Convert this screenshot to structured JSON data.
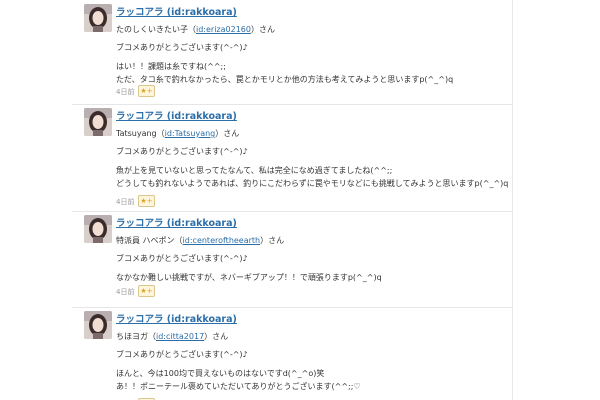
{
  "comments": [
    {
      "username": "ラッコアラ (id:rakkoara)",
      "reply_name": "たのしくいきたい子（",
      "reply_id": "id:eriza02160",
      "reply_suffix": "）さん",
      "lines": [
        "ブコメありがとうございます(^-^)♪",
        "はい！！課題は糸ですね(^^;;",
        "ただ、タコ糸で釣れなかったら、罠とかモリとか他の方法も考えてみようと思いますp(^_^)q"
      ],
      "date": "4日前",
      "star_icon": "★+"
    },
    {
      "username": "ラッコアラ (id:rakkoara)",
      "reply_name": "Tatsuyang（",
      "reply_id": "id:Tatsuyang",
      "reply_suffix": "）さん",
      "lines": [
        "ブコメありがとうございます(^-^)♪",
        "魚が上を見ていないと思ってたなんて、私は完全になめ過ぎてましたね(^^;;",
        "どうしても釣れないようであれば、釣りにこだわらずに罠やモリなどにも挑戦してみようと思いますp(^_^)q"
      ],
      "date": "4日前",
      "star_icon": "★+"
    },
    {
      "username": "ラッコアラ (id:rakkoara)",
      "reply_name": "特派員 ハベポン（",
      "reply_id": "id:centeroftheearth",
      "reply_suffix": "）さん",
      "lines": [
        "ブコメありがとうございます(^-^)♪",
        "なかなか難しい挑戦ですが、ネバーギブアップ！！で頑張りますp(^_^)q"
      ],
      "date": "4日前",
      "star_icon": "★+"
    },
    {
      "username": "ラッコアラ (id:rakkoara)",
      "reply_name": "ちほヨガ（",
      "reply_id": "id:citta2017",
      "reply_suffix": "）さん",
      "lines": [
        "ブコメありがとうございます(^-^)♪",
        "ほんと、今は100均で買えないものはないですd(^_^o)笑",
        "あ！！ポニーテール褒めていただいてありがとうございます(^^;;♡"
      ],
      "date": "4日前",
      "star_icon": "★+"
    }
  ],
  "colors": {
    "link": "#2b6ea8",
    "text": "#333333",
    "meta": "#999999",
    "star": "#e0a21b"
  }
}
